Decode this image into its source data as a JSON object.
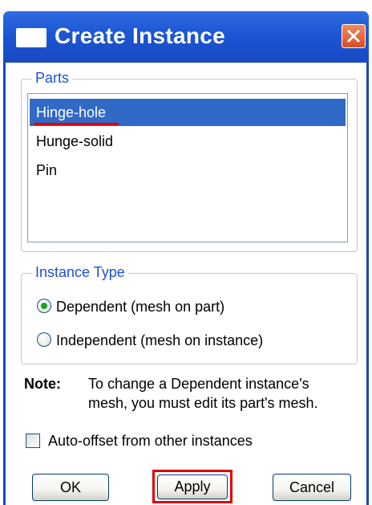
{
  "window": {
    "title": "Create Instance"
  },
  "parts": {
    "group_label": "Parts",
    "items": [
      {
        "label": "Hinge-hole",
        "selected": true
      },
      {
        "label": "Hunge-solid",
        "selected": false
      },
      {
        "label": "Pin",
        "selected": false
      }
    ]
  },
  "instance_type": {
    "group_label": "Instance Type",
    "options": [
      {
        "label": "Dependent (mesh on part)",
        "checked": true
      },
      {
        "label": "Independent (mesh on instance)",
        "checked": false
      }
    ]
  },
  "note": {
    "label": "Note:",
    "line1": "To change a Dependent instance's",
    "line2": "mesh, you must edit its part's mesh."
  },
  "auto_offset": {
    "label": "Auto-offset from other instances",
    "checked": false
  },
  "buttons": {
    "ok": "OK",
    "apply": "Apply",
    "cancel": "Cancel"
  },
  "colors": {
    "titlebar": "#1c56d4",
    "selection": "#3169c6",
    "group_label": "#1d50d8",
    "highlight_red": "#e00000",
    "radio_dot": "#21a121"
  },
  "icons": {
    "title": "window-icon",
    "close": "close-x-icon"
  }
}
